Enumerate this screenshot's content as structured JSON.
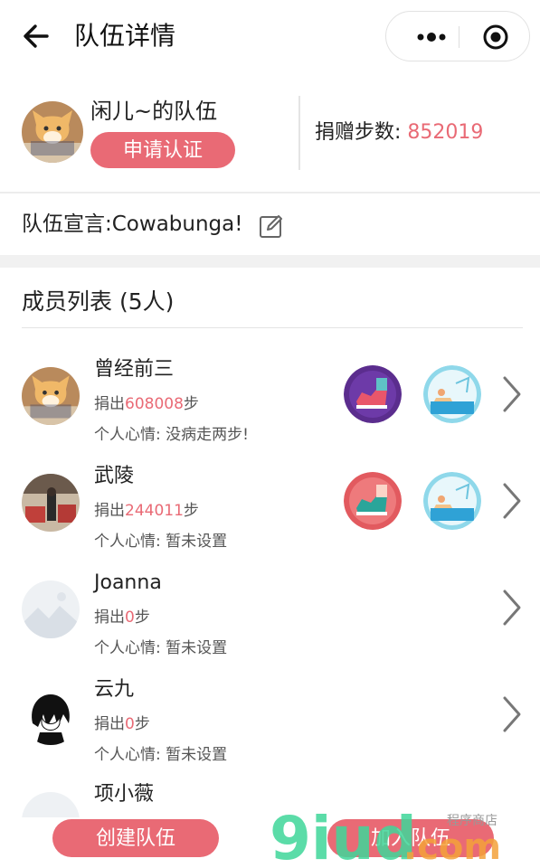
{
  "header": {
    "title": "队伍详情"
  },
  "team": {
    "name": "闲儿~的队伍",
    "verify_label": "申请认证",
    "donate_label": "捐赠步数:",
    "donate_value": "852019",
    "declaration": "队伍宣言:Cowabunga!"
  },
  "members_title": "成员列表 (5人)",
  "members": [
    {
      "name": "曾经前三",
      "steps_prefix": "捐出",
      "steps": "608008",
      "steps_suffix": "步",
      "mood": "个人心情: 没病走两步!"
    },
    {
      "name": "武陵",
      "steps_prefix": "捐出",
      "steps": "244011",
      "steps_suffix": "步",
      "mood": "个人心情: 暂未设置"
    },
    {
      "name": "Joanna",
      "steps_prefix": "捐出",
      "steps": "0",
      "steps_suffix": "步",
      "mood": "个人心情: 暂未设置"
    },
    {
      "name": "云九",
      "steps_prefix": "捐出",
      "steps": "0",
      "steps_suffix": "步",
      "mood": "个人心情: 暂未设置"
    },
    {
      "name": "项小薇"
    }
  ],
  "footer": {
    "create_label": "创建队伍",
    "join_label": "加入队伍"
  },
  "watermark": {
    "brand": "9iud.com",
    "tagline": "程序商店"
  },
  "colors": {
    "accent": "#e96a75",
    "divider": "#e4e4e4",
    "section_gap": "#f1f1f1"
  },
  "icons": {
    "back": "back-arrow-icon",
    "more": "more-dots-icon",
    "close": "mini-program-close-icon",
    "edit": "edit-pencil-icon",
    "chevron": "chevron-right-icon",
    "badge_walk": "walking-shoe-badge-icon",
    "badge_beach": "beach-badge-icon"
  }
}
